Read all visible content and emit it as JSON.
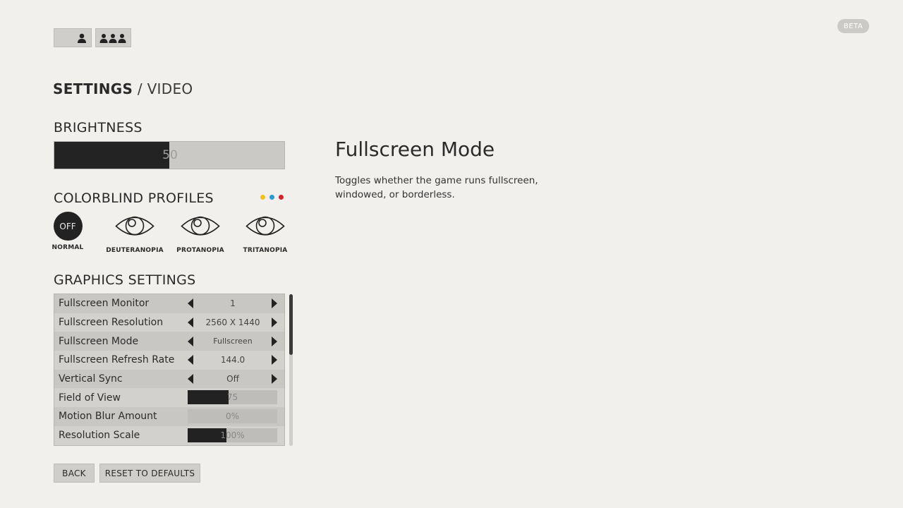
{
  "header": {
    "beta_badge": "BETA",
    "player_buttons": [
      {
        "icon": "single-player-icon"
      },
      {
        "icon": "multi-player-icon"
      }
    ]
  },
  "page": {
    "title_bold": "SETTINGS",
    "title_rest": " / VIDEO"
  },
  "brightness": {
    "label": "BRIGHTNESS",
    "value": "50",
    "fraction": 0.5
  },
  "colorblind": {
    "label": "COLORBLIND PROFILES",
    "dot_colors": [
      "#f2c21b",
      "#2a9ad6",
      "#d3242b"
    ],
    "profiles": [
      {
        "label": "NORMAL",
        "badge": "OFF",
        "icon": "off-badge"
      },
      {
        "label": "DEUTERANOPIA",
        "icon": "eye-icon"
      },
      {
        "label": "PROTANOPIA",
        "icon": "eye-icon"
      },
      {
        "label": "TRITANOPIA",
        "icon": "eye-icon"
      }
    ]
  },
  "graphics": {
    "label": "GRAPHICS SETTINGS",
    "rows": [
      {
        "name": "Fullscreen Monitor",
        "type": "select",
        "value": "1"
      },
      {
        "name": "Fullscreen Resolution",
        "type": "select",
        "value": "2560 X 1440"
      },
      {
        "name": "Fullscreen Mode",
        "type": "select",
        "value": "Fullscreen"
      },
      {
        "name": "Fullscreen Refresh Rate",
        "type": "select",
        "value": "144.0"
      },
      {
        "name": "Vertical Sync",
        "type": "select",
        "value": "Off"
      },
      {
        "name": "Field of View",
        "type": "slider",
        "value": "75",
        "fraction": 0.46
      },
      {
        "name": "Motion Blur Amount",
        "type": "slider",
        "value": "0%",
        "fraction": 0
      },
      {
        "name": "Resolution Scale",
        "type": "slider",
        "value": "100%",
        "fraction": 0.43
      }
    ],
    "scroll_fraction": 0.4
  },
  "footer": {
    "back_label": "BACK",
    "reset_label": "RESET TO DEFAULTS"
  },
  "description": {
    "title": "Fullscreen Mode",
    "text": "Toggles whether the game runs fullscreen, windowed, or borderless."
  }
}
